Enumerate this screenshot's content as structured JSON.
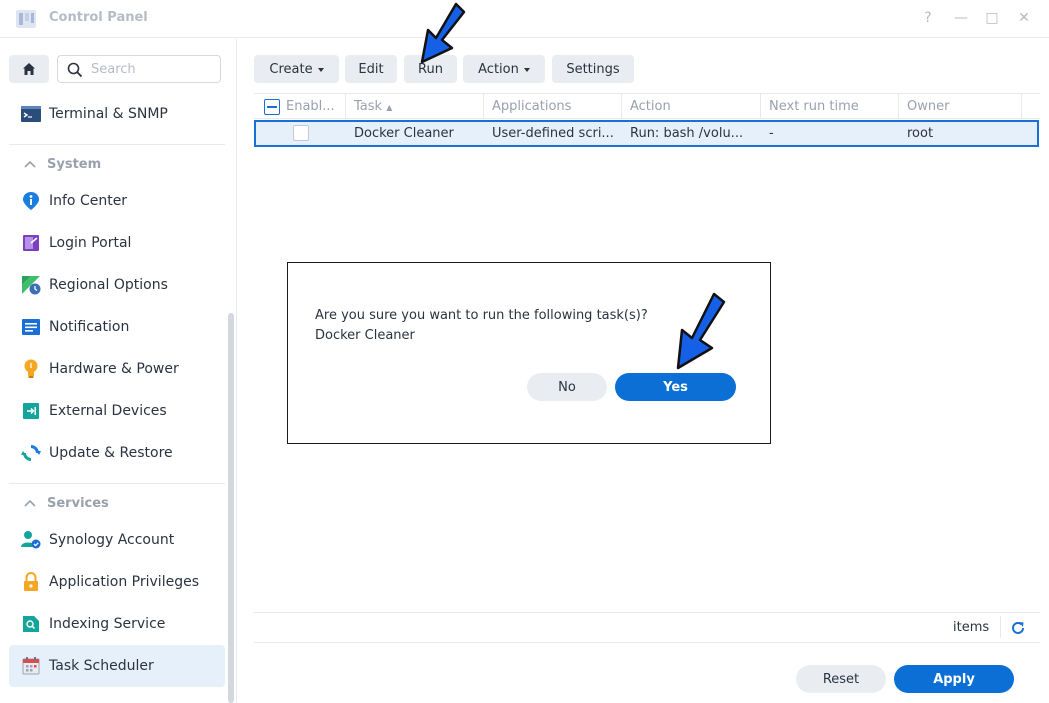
{
  "window": {
    "title": "Control Panel",
    "help": "?",
    "minimize": "—",
    "maximize": "□",
    "close": "✕"
  },
  "sidebar": {
    "search_placeholder": "Search",
    "items": [
      {
        "label": "Terminal & SNMP"
      },
      {
        "label": "Info Center"
      },
      {
        "label": "Login Portal"
      },
      {
        "label": "Regional Options"
      },
      {
        "label": "Notification"
      },
      {
        "label": "Hardware & Power"
      },
      {
        "label": "External Devices"
      },
      {
        "label": "Update & Restore"
      },
      {
        "label": "Synology Account"
      },
      {
        "label": "Application Privileges"
      },
      {
        "label": "Indexing Service"
      },
      {
        "label": "Task Scheduler"
      }
    ],
    "sections": {
      "system": "System",
      "services": "Services"
    }
  },
  "toolbar": {
    "create": "Create",
    "edit": "Edit",
    "run": "Run",
    "action": "Action",
    "settings": "Settings"
  },
  "grid": {
    "columns": [
      "Enabl...",
      "Task",
      "Applications",
      "Action",
      "Next run time",
      "Owner"
    ],
    "rows": [
      {
        "task": "Docker Cleaner",
        "applications": "User-defined scri...",
        "action": "Run: bash /volu...",
        "next_run": "-",
        "owner": "root"
      }
    ]
  },
  "footer": {
    "items": "items",
    "reset": "Reset",
    "apply": "Apply"
  },
  "dialog": {
    "message": "Are you sure you want to run the following task(s)?",
    "task": "Docker Cleaner",
    "no": "No",
    "yes": "Yes"
  },
  "colors": {
    "accent": "#0b6fd6",
    "selection_border": "#1a6fd6",
    "arrow": "#1560e6"
  }
}
